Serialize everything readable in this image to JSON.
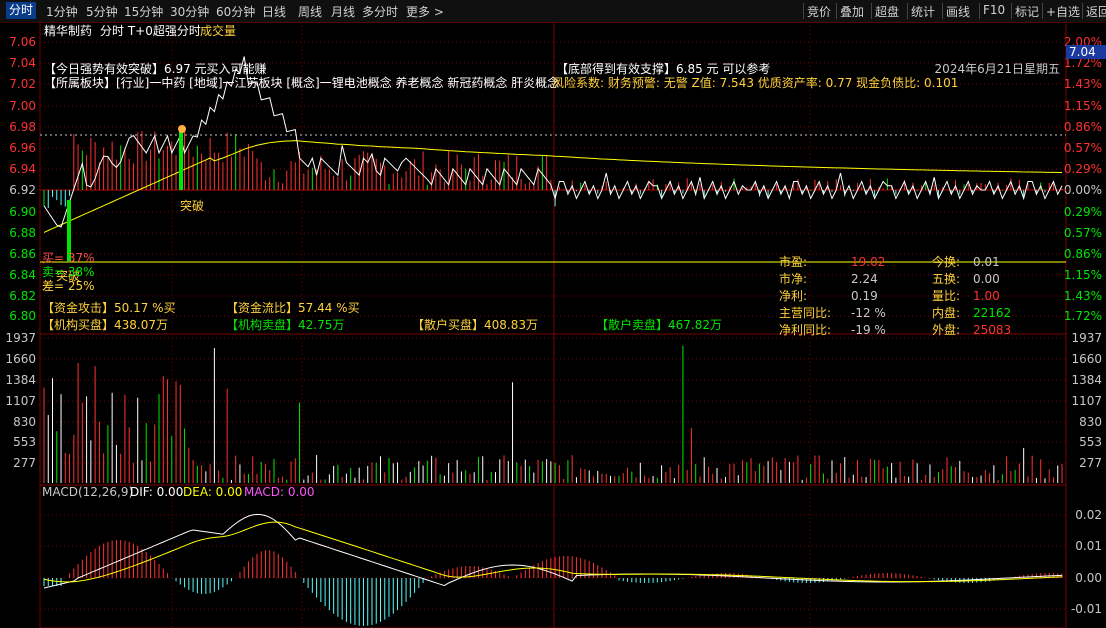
{
  "toolbar": {
    "tabs": [
      "分时",
      "1分钟",
      "5分钟",
      "15分钟",
      "30分钟",
      "60分钟",
      "日线",
      "周线",
      "月线",
      "多分时",
      "更多 >"
    ],
    "active_tab": "分时",
    "right_buttons": [
      "竞价",
      "叠加",
      "超盘",
      "统计",
      "画线",
      "F10",
      "标记",
      "+自选",
      "返回"
    ]
  },
  "header": {
    "stock_name": "精华制药",
    "indicators": "分时 T+0超强分时",
    "volume_label": "成交量",
    "date": "2024年6月21日星期五",
    "current_price_tag": "7.04"
  },
  "price_axis": {
    "left": [
      "7.06",
      "7.04",
      "7.02",
      "7.00",
      "6.98",
      "6.96",
      "6.94",
      "6.92",
      "6.90",
      "6.88",
      "6.86",
      "6.84",
      "6.82",
      "6.80"
    ],
    "right": [
      "2.00%",
      "1.72%",
      "1.43%",
      "1.15%",
      "0.86%",
      "0.57%",
      "0.29%",
      "0.00%",
      "0.29%",
      "0.57%",
      "0.86%",
      "1.15%",
      "1.43%",
      "1.72%"
    ]
  },
  "volume_axis": {
    "ticks": [
      "1937",
      "1660",
      "1384",
      "1107",
      "830",
      "553",
      "277"
    ]
  },
  "macd_axis": {
    "ticks": [
      "0.02",
      "0.01",
      "0.00",
      "-0.01"
    ]
  },
  "info": {
    "line1_left": "【今日强势有效突破】6.97 元买入可能赚",
    "line1_right": "【底部得到有效支撑】6.85 元 可以参考",
    "line2_white": "【所属板块】[行业]一中药 [地域]一江苏板块 [概念]一锂电池概念 养老概念 新冠药概念 肝炎概念",
    "line2_yellow": "风险系数: 财务预警: 无警 Z值: 7.543 优质资产率: 0.77 现金负债比: 0.101",
    "breakout_label_1": "突破",
    "breakout_label_2": "突破",
    "buy_label": "买= 37%",
    "sell_label": "卖= 38%",
    "diff_label": "差= 25%",
    "fund_attack": "【资金攻击】50.17 %买",
    "fund_outflow": "【资金流比】57.44 %买",
    "inst_buy": "【机构买盘】438.07万",
    "inst_sell": "【机构卖盘】42.75万",
    "retail_buy": "【散户买盘】408.83万",
    "retail_sell": "【散户卖盘】467.82万"
  },
  "stats": {
    "left_labels": [
      "市盈:",
      "市净:",
      "净利:",
      "主营同比:",
      "净利同比:"
    ],
    "left_values": [
      "19.02",
      "2.24",
      "0.19",
      "-12 %",
      "-19 %"
    ],
    "right_labels": [
      "今换:",
      "五换:",
      "量比:",
      "内盘:",
      "外盘:"
    ],
    "right_values": [
      "0.01",
      "0.00",
      "1.00",
      "22162",
      "25083"
    ]
  },
  "macd": {
    "title": "MACD(12,26,9)",
    "dif": "DIF: 0.00",
    "dea": "DEA: 0.00",
    "macd": "MACD: 0.00"
  },
  "colors": {
    "up": "#ff3232",
    "down": "#54fcfc",
    "green": "#00e600",
    "grid": "#7a0000",
    "price_line": "#ffffff",
    "avg_line": "#ffff00",
    "label_yellow": "#ffd23c",
    "cyan_text": "#54fcfc"
  }
}
